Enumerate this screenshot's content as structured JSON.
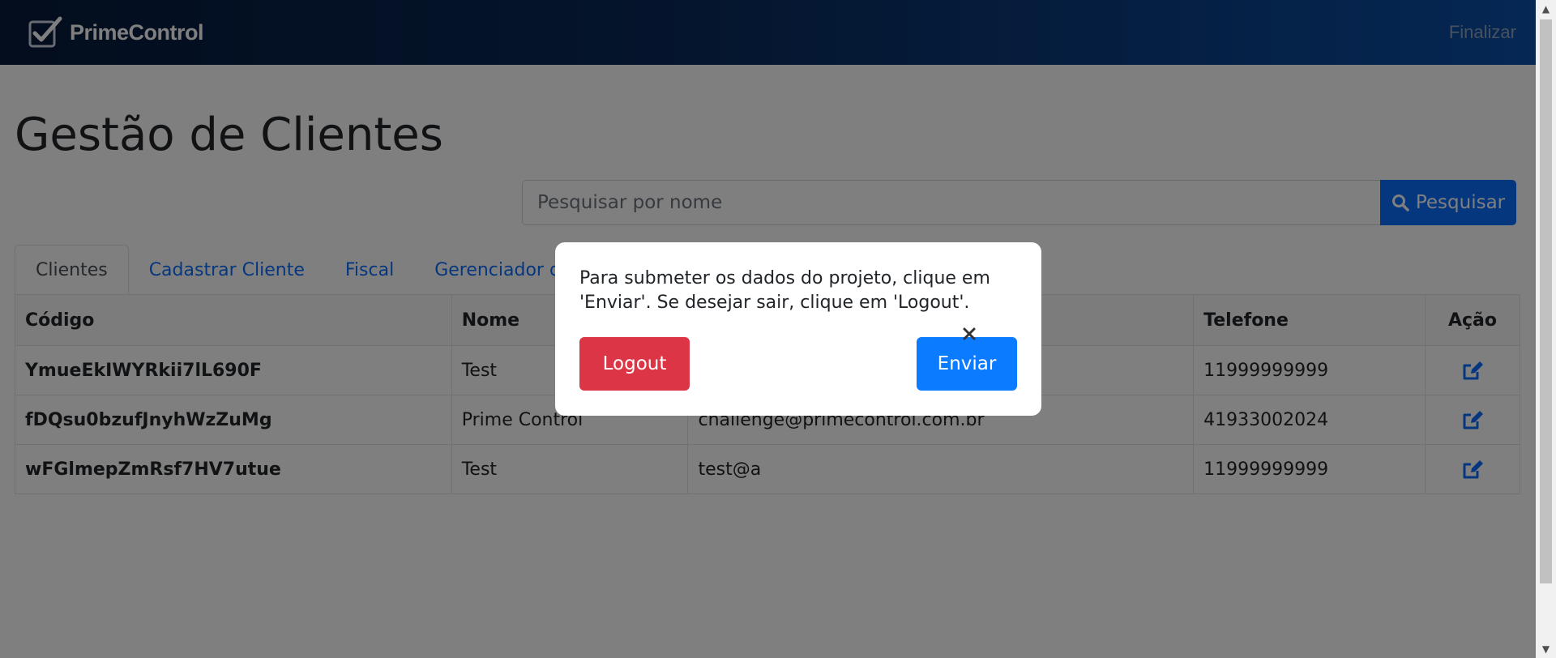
{
  "navbar": {
    "brand": "PrimeControl",
    "finalize_label": "Finalizar"
  },
  "page": {
    "title": "Gestão de Clientes"
  },
  "search": {
    "placeholder": "Pesquisar por nome",
    "button_label": "Pesquisar"
  },
  "tabs": [
    {
      "label": "Clientes",
      "active": true
    },
    {
      "label": "Cadastrar Cliente"
    },
    {
      "label": "Fiscal"
    },
    {
      "label": "Gerenciador de"
    }
  ],
  "table": {
    "headers": [
      "Código",
      "Nome",
      "",
      "Telefone",
      "Ação"
    ],
    "rows": [
      {
        "code": "YmueEkIWYRkii7lL690F",
        "name": "Test",
        "email": "",
        "phone": "11999999999"
      },
      {
        "code": "fDQsu0bzufJnyhWzZuMg",
        "name": "Prime Control",
        "email": "challenge@primecontrol.com.br",
        "phone": "41933002024"
      },
      {
        "code": "wFGlmepZmRsf7HV7utue",
        "name": "Test",
        "email": "test@a",
        "phone": "11999999999"
      }
    ]
  },
  "modal": {
    "message": "Para submeter os dados do projeto, clique em 'Enviar'. Se desejar sair, clique em 'Logout'.",
    "logout_label": "Logout",
    "send_label": "Enviar"
  },
  "colors": {
    "primary": "#0b6efd",
    "danger": "#dc3545",
    "navbar_dark": "#061a3a"
  },
  "icons": {
    "search": "search-icon",
    "edit": "edit-icon",
    "close": "close-icon",
    "logo": "checkbox-logo-icon"
  }
}
